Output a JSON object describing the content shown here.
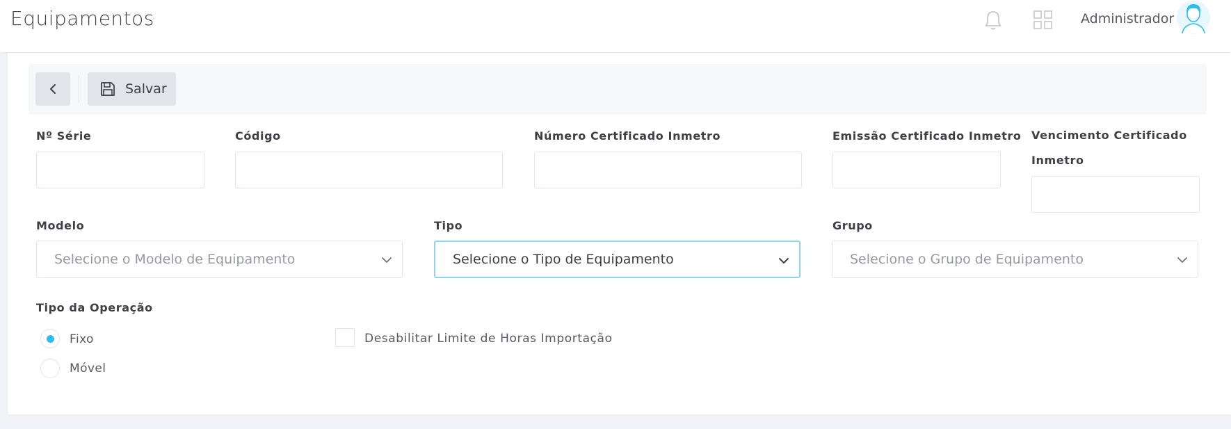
{
  "header": {
    "title": "Equipamentos",
    "username": "Administrador",
    "icons": {
      "bell": "bell-icon",
      "apps": "apps-grid-icon",
      "avatar": "user-avatar-icon"
    }
  },
  "toolbar": {
    "back_icon": "chevron-left-icon",
    "save_icon": "floppy-disk-icon",
    "save_label": "Salvar"
  },
  "form": {
    "serie": {
      "label": "Nº Série",
      "value": ""
    },
    "codigo": {
      "label": "Código",
      "value": ""
    },
    "numero_certificado": {
      "label": "Número Certificado Inmetro",
      "value": ""
    },
    "emissao_certificado": {
      "label": "Emissão Certificado Inmetro",
      "value": ""
    },
    "vencimento_certificado": {
      "label_line1": "Vencimento Certificado",
      "label_line2": "Inmetro",
      "value": ""
    },
    "modelo": {
      "label": "Modelo",
      "placeholder": "Selecione o Modelo de Equipamento"
    },
    "tipo": {
      "label": "Tipo",
      "selected": "Selecione o Tipo de Equipamento"
    },
    "grupo": {
      "label": "Grupo",
      "placeholder": "Selecione o Grupo de Equipamento"
    },
    "tipo_operacao": {
      "label": "Tipo da Operação",
      "options": [
        {
          "label": "Fixo",
          "checked": true
        },
        {
          "label": "Móvel",
          "checked": false
        }
      ]
    },
    "desabilitar_limite": {
      "label": "Desabilitar Limite de Horas Importação",
      "checked": false
    }
  },
  "colors": {
    "accent": "#2dbdf0",
    "focus_border": "#8ed4ea",
    "toolbar_button": "#e2e4ea"
  }
}
